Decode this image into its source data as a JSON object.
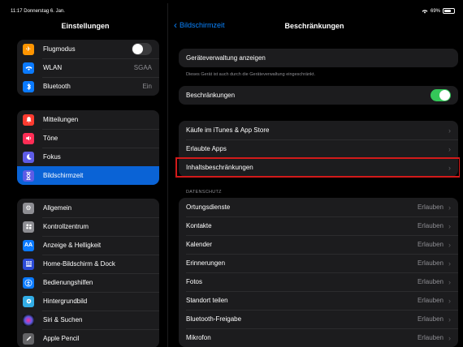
{
  "status": {
    "time_date": "11:17  Donnerstag 6. Jan.",
    "battery": "69%",
    "battery_level": 0.69
  },
  "sidebar": {
    "title": "Einstellungen",
    "group1": [
      {
        "label": "Flugmodus",
        "icon": "airplane-icon",
        "icon_color": "#ff9500",
        "toggle": "off"
      },
      {
        "label": "WLAN",
        "value": "SGAA",
        "icon": "wifi-icon",
        "icon_color": "#0a7aff"
      },
      {
        "label": "Bluetooth",
        "value": "Ein",
        "icon": "bluetooth-icon",
        "icon_color": "#0a7aff"
      }
    ],
    "group2": [
      {
        "label": "Mitteilungen",
        "icon": "bell-icon",
        "icon_color": "#ff3b30"
      },
      {
        "label": "Töne",
        "icon": "speaker-icon",
        "icon_color": "#ff2d55"
      },
      {
        "label": "Fokus",
        "icon": "moon-icon",
        "icon_color": "#5e5ce6"
      },
      {
        "label": "Bildschirmzeit",
        "icon": "hourglass-icon",
        "icon_color": "#5e5ce6",
        "active": true
      }
    ],
    "group3": [
      {
        "label": "Allgemein",
        "icon": "gear-icon",
        "icon_color": "#8e8e93"
      },
      {
        "label": "Kontrollzentrum",
        "icon": "control-center-icon",
        "icon_color": "#8e8e93"
      },
      {
        "label": "Anzeige & Helligkeit",
        "icon": "text-size-icon",
        "icon_color": "#0a7aff"
      },
      {
        "label": "Home-Bildschirm & Dock",
        "icon": "home-grid-icon",
        "icon_color": "#2c4bd6"
      },
      {
        "label": "Bedienungshilfen",
        "icon": "accessibility-icon",
        "icon_color": "#0a7aff"
      },
      {
        "label": "Hintergrundbild",
        "icon": "wallpaper-icon",
        "icon_color": "#32ade6"
      },
      {
        "label": "Siri & Suchen",
        "icon": "siri-icon",
        "icon_color": "#222"
      },
      {
        "label": "Apple Pencil",
        "icon": "pencil-icon",
        "icon_color": "#636366"
      }
    ]
  },
  "main": {
    "back_label": "Bildschirmzeit",
    "title": "Beschränkungen",
    "device_management_link": "Geräteverwaltung anzeigen",
    "device_management_note": "Dieses Gerät ist auch durch die Geräteverwaltung eingeschränkt.",
    "restrictions_label": "Beschränkungen",
    "restrictions_toggle": "on",
    "store_group": [
      {
        "label": "Käufe im iTunes & App Store"
      },
      {
        "label": "Erlaubte Apps"
      },
      {
        "label": "Inhaltsbeschränkungen",
        "highlighted": true
      }
    ],
    "privacy_header": "DATENSCHUTZ",
    "privacy_items": [
      {
        "label": "Ortungsdienste",
        "value": "Erlauben"
      },
      {
        "label": "Kontakte",
        "value": "Erlauben"
      },
      {
        "label": "Kalender",
        "value": "Erlauben"
      },
      {
        "label": "Erinnerungen",
        "value": "Erlauben"
      },
      {
        "label": "Fotos",
        "value": "Erlauben"
      },
      {
        "label": "Standort teilen",
        "value": "Erlauben"
      },
      {
        "label": "Bluetooth-Freigabe",
        "value": "Erlauben"
      },
      {
        "label": "Mikrofon",
        "value": "Erlauben"
      }
    ]
  }
}
